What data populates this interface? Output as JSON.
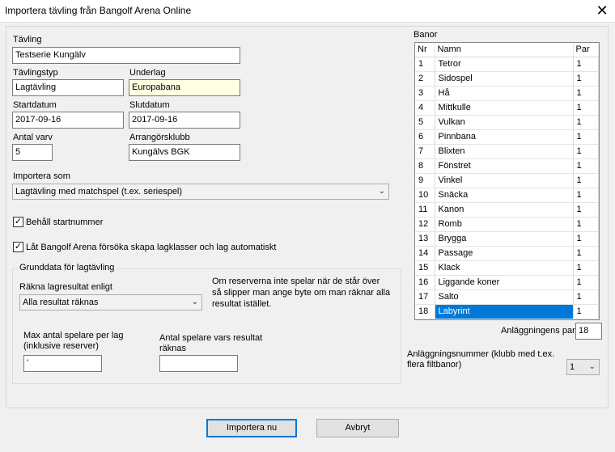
{
  "window": {
    "title": "Importera tävling från Bangolf Arena Online",
    "close_glyph": "✕"
  },
  "form": {
    "tavling_label": "Tävling",
    "tavling_value": "Testserie Kungälv",
    "tavlingstyp_label": "Tävlingstyp",
    "tavlingstyp_value": "Lagtävling",
    "underlag_label": "Underlag",
    "underlag_value": "Europabana",
    "startdatum_label": "Startdatum",
    "startdatum_value": "2017-09-16",
    "slutdatum_label": "Slutdatum",
    "slutdatum_value": "2017-09-16",
    "antal_varv_label": "Antal varv",
    "antal_varv_value": "5",
    "arrangorsklubb_label": "Arrangörsklubb",
    "arrangorsklubb_value": "Kungälvs BGK",
    "importera_som_label": "Importera som",
    "importera_som_value": "Lagtävling med matchspel (t.ex. seriespel)",
    "behall_label": "Behåll startnummer",
    "lagklasser_label": "Låt Bangolf Arena försöka skapa lagklasser och lag automatiskt",
    "check_glyph": "✓"
  },
  "grunddata": {
    "title": "Grunddata för lagtävling",
    "rakna_label": "Räkna lagresultat enligt",
    "rakna_value": "Alla resultat räknas",
    "info_text_1": "Om reserverna inte spelar när de står över",
    "info_text_2": "så slipper man ange byte om man räknar alla",
    "info_text_3": "resultat istället.",
    "max_label_1": "Max antal spelare per lag",
    "max_label_2": "(inklusive reserver)",
    "max_value": "'",
    "antal_label_1": "Antal spelare vars resultat",
    "antal_label_2": "räknas",
    "antal_value": ""
  },
  "banor": {
    "title": "Banor",
    "col_nr": "Nr",
    "col_namn": "Namn",
    "col_par": "Par",
    "rows": [
      {
        "nr": "1",
        "namn": "Tetror",
        "par": "1"
      },
      {
        "nr": "2",
        "namn": "Sidospel",
        "par": "1"
      },
      {
        "nr": "3",
        "namn": "Hå",
        "par": "1"
      },
      {
        "nr": "4",
        "namn": "Mittkulle",
        "par": "1"
      },
      {
        "nr": "5",
        "namn": "Vulkan",
        "par": "1"
      },
      {
        "nr": "6",
        "namn": "Pinnbana",
        "par": "1"
      },
      {
        "nr": "7",
        "namn": "Blixten",
        "par": "1"
      },
      {
        "nr": "8",
        "namn": "Fönstret",
        "par": "1"
      },
      {
        "nr": "9",
        "namn": "Vinkel",
        "par": "1"
      },
      {
        "nr": "10",
        "namn": "Snäcka",
        "par": "1"
      },
      {
        "nr": "11",
        "namn": "Kanon",
        "par": "1"
      },
      {
        "nr": "12",
        "namn": "Romb",
        "par": "1"
      },
      {
        "nr": "13",
        "namn": "Brygga",
        "par": "1"
      },
      {
        "nr": "14",
        "namn": "Passage",
        "par": "1"
      },
      {
        "nr": "15",
        "namn": "Klack",
        "par": "1"
      },
      {
        "nr": "16",
        "namn": "Liggande koner",
        "par": "1"
      },
      {
        "nr": "17",
        "namn": "Salto",
        "par": "1"
      },
      {
        "nr": "18",
        "namn": "Labyrint",
        "par": "1"
      }
    ],
    "selected_nr": "18",
    "anlaggningens_par_label": "Anläggningens par",
    "anlaggningens_par_value": "18",
    "anlaggningsnummer_label_1": "Anläggningsnummer (klubb med t.ex.",
    "anlaggningsnummer_label_2": "flera filtbanor)",
    "anlaggningsnummer_value": "1"
  },
  "buttons": {
    "importera": "Importera nu",
    "avbryt": "Avbryt"
  },
  "colors": {
    "selection": "#0078d7",
    "highlight_field": "#ffffe1"
  }
}
